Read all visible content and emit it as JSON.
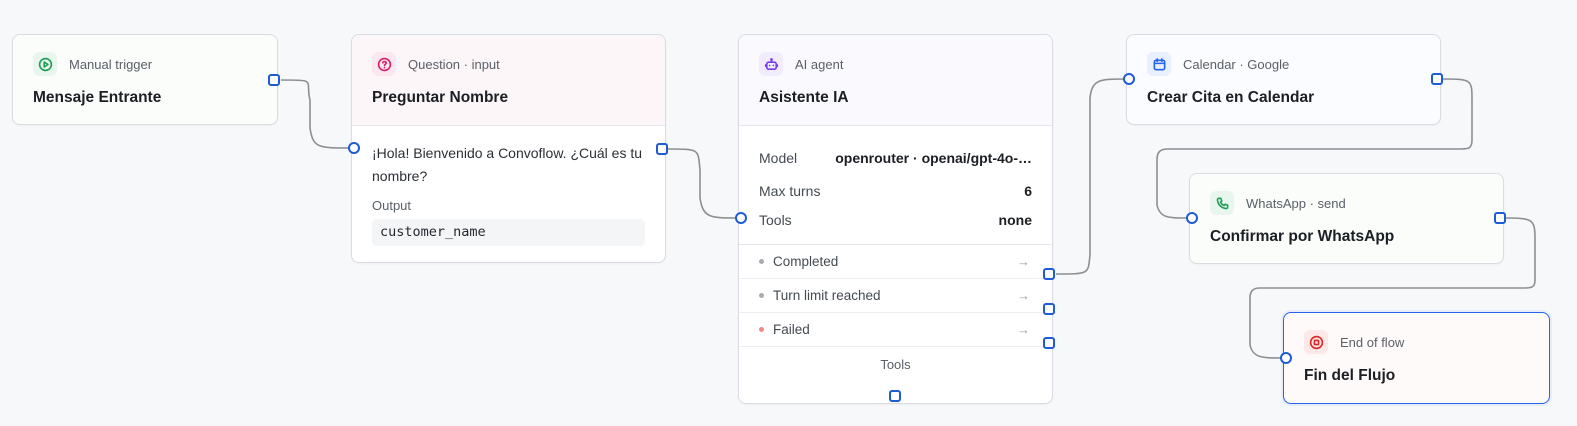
{
  "colors": {
    "accent": "#2563eb",
    "edge": "#8c8f94",
    "handle": "#1d5bd8"
  },
  "nodes": {
    "trigger": {
      "kind": "Manual trigger",
      "title": "Mensaje Entrante",
      "icon": "play-circle-icon"
    },
    "question": {
      "kind": "Question · input",
      "title": "Preguntar Nombre",
      "icon": "question-circle-icon",
      "text": "¡Hola! Bienvenido a Convoflow. ¿Cuál es tu nombre?",
      "output_label": "Output",
      "output_value": "customer_name"
    },
    "ai": {
      "kind": "AI agent",
      "title": "Asistente IA",
      "icon": "robot-icon",
      "model_label": "Model",
      "model_value": "openrouter · openai/gpt-4o-…",
      "max_turns_label": "Max turns",
      "max_turns_value": "6",
      "tools_label": "Tools",
      "tools_value": "none",
      "outcomes": [
        "Completed",
        "Turn limit reached",
        "Failed"
      ],
      "footer": "Tools"
    },
    "calendar": {
      "kind": "Calendar · Google",
      "title": "Crear Cita en Calendar",
      "icon": "calendar-icon"
    },
    "whatsapp": {
      "kind": "WhatsApp · send",
      "title": "Confirmar por WhatsApp",
      "icon": "phone-icon"
    },
    "end": {
      "kind": "End of flow",
      "title": "Fin del Flujo",
      "icon": "stop-circle-icon"
    }
  }
}
